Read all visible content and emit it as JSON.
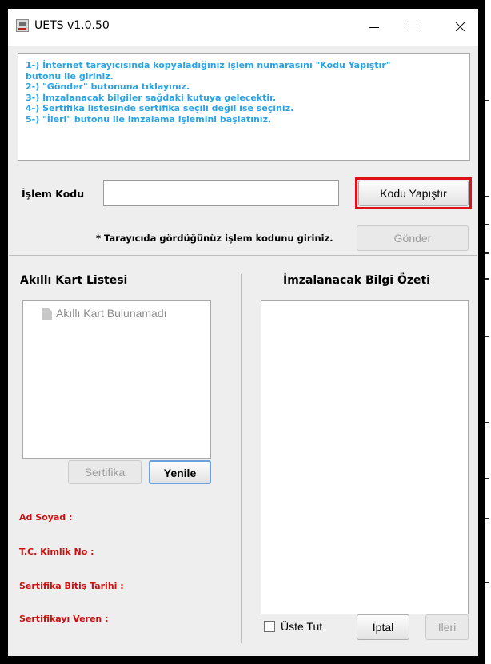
{
  "window": {
    "title": "UETS v1.0.50"
  },
  "instructions": [
    "1-) İnternet tarayıcısında kopyaladığınız işlem numarasını \"Kodu Yapıştır\"",
    "butonu ile giriniz.",
    "2-) \"Gönder\" butonuna tıklayınız.",
    "3-) İmzalanacak bilgiler sağdaki kutuya gelecektir.",
    "4-) Sertifika listesinde sertifika seçili değil ise seçiniz.",
    "5-) \"İleri\" butonu ile imzalama işlemini başlatınız."
  ],
  "code_row": {
    "label": "İşlem Kodu",
    "value": "",
    "paste_button": "Kodu Yapıştır"
  },
  "hint": {
    "text": "* Tarayıcıda gördüğünüz işlem kodunu giriniz.",
    "send_button": "Gönder"
  },
  "card_panel": {
    "title": "Akıllı Kart Listesi",
    "empty_item": "Akıllı Kart Bulunamadı",
    "certificate_button": "Sertifika",
    "refresh_button": "Yenile"
  },
  "info_labels": {
    "name": "Ad Soyad :",
    "id_no": "T.C. Kimlik No :",
    "expiry": "Sertifika Bitiş Tarihi :",
    "issuer": "Sertifikayı Veren :"
  },
  "summary_panel": {
    "title": "İmzalanacak Bilgi Özeti"
  },
  "bottom": {
    "keep_on_top_label": "Üste Tut",
    "keep_on_top_checked": false,
    "cancel_button": "İptal",
    "next_button": "İleri"
  },
  "colors": {
    "instruction_text": "#29a3e3",
    "highlight_outline": "#e0101a",
    "info_label": "#cc1010",
    "disabled_text": "#9d9d9d"
  }
}
